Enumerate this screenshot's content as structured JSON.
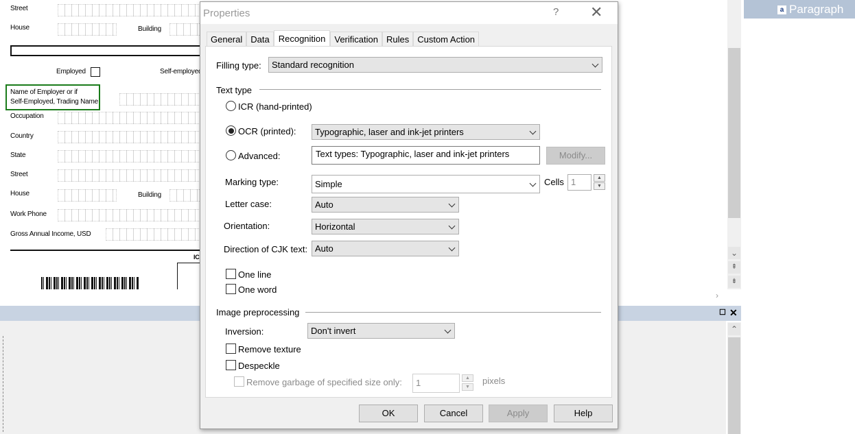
{
  "background_form": {
    "labels": {
      "street": "Street",
      "house": "House",
      "building": "Building",
      "employed": "Employed",
      "self_employed": "Self-employed",
      "employer_name_line1": "Name of Employer or if",
      "employer_name_line2": "Self-Employed, Trading Name",
      "occupation": "Occupation",
      "country": "Country",
      "state": "State",
      "street2": "Street",
      "house2": "House",
      "building2": "Building",
      "work_phone": "Work Phone",
      "gross_income": "Gross Annual Income, USD",
      "ic": "IC"
    }
  },
  "right_pane": {
    "paragraph_icon": "a",
    "paragraph_label": "Paragraph"
  },
  "dialog": {
    "title": "Properties",
    "help_glyph": "?",
    "close_glyph": "✕",
    "tabs": [
      {
        "label": "General"
      },
      {
        "label": "Data"
      },
      {
        "label": "Recognition",
        "active": true
      },
      {
        "label": "Verification"
      },
      {
        "label": "Rules"
      },
      {
        "label": "Custom Action"
      }
    ],
    "filling_type": {
      "label": "Filling type:",
      "value": "Standard recognition"
    },
    "text_type": {
      "group_label": "Text type",
      "icr_label": "ICR (hand-printed)",
      "ocr_label": "OCR (printed):",
      "ocr_value": "Typographic, laser and ink-jet printers",
      "advanced_label": "Advanced:",
      "advanced_value": "Text types: Typographic, laser and ink-jet printers",
      "modify_label": "Modify...",
      "selected": "ocr"
    },
    "marking_type": {
      "label": "Marking type:",
      "value": "Simple"
    },
    "cells": {
      "label": "Cells",
      "value": "1"
    },
    "letter_case": {
      "label": "Letter case:",
      "value": "Auto"
    },
    "orientation": {
      "label": "Orientation:",
      "value": "Horizontal"
    },
    "cjk_direction": {
      "label": "Direction of CJK text:",
      "value": "Auto"
    },
    "one_line": {
      "label": "One line",
      "checked": false
    },
    "one_word": {
      "label": "One word",
      "checked": false
    },
    "image_preprocessing": {
      "group_label": "Image preprocessing",
      "inversion_label": "Inversion:",
      "inversion_value": "Don't invert",
      "remove_texture_label": "Remove texture",
      "despeckle_label": "Despeckle",
      "remove_garbage_label": "Remove garbage of specified size only:",
      "garbage_size_value": "1",
      "pixels_label": "pixels"
    },
    "buttons": {
      "ok": "OK",
      "cancel": "Cancel",
      "apply": "Apply",
      "help": "Help"
    }
  },
  "colors": {
    "highlight_box": "#1a7b1a",
    "paragraph_bar": "#b4c3d6",
    "bottom_strip": "#c8d3e2"
  }
}
